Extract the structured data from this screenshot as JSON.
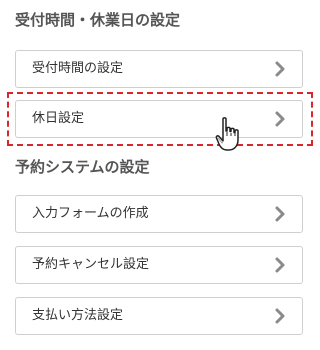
{
  "sections": [
    {
      "heading": "受付時間・休業日の設定",
      "items": [
        {
          "label": "受付時間の設定",
          "icon": "chevron-right-icon"
        },
        {
          "label": "休日設定",
          "icon": "chevron-right-icon",
          "highlighted": true
        }
      ]
    },
    {
      "heading": "予約システムの設定",
      "items": [
        {
          "label": "入力フォームの作成",
          "icon": "chevron-right-icon"
        },
        {
          "label": "予約キャンセル設定",
          "icon": "chevron-right-icon"
        },
        {
          "label": "支払い方法設定",
          "icon": "chevron-right-icon"
        }
      ]
    }
  ],
  "colors": {
    "highlight": "#d8262a",
    "chevron": "#8a8a8a",
    "border": "#cfcfcf"
  },
  "cursor": "hand-pointer-icon"
}
